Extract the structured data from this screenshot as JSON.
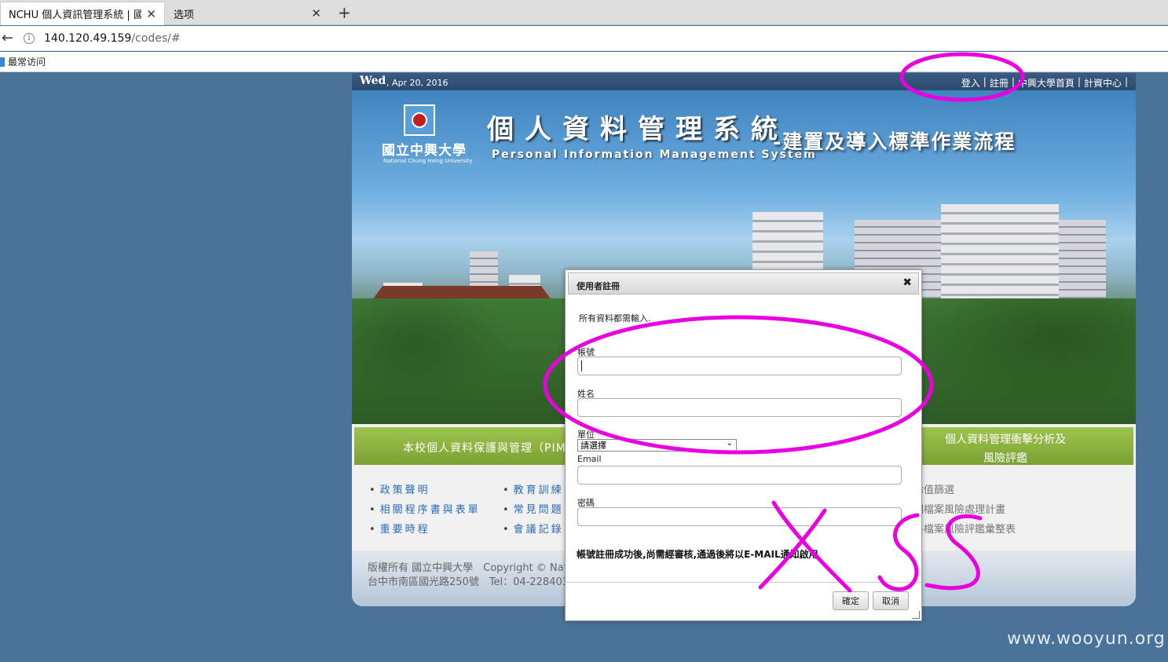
{
  "browser": {
    "tabs": [
      {
        "title": "NCHU 個人資訊管理系統 | 國...",
        "close": "✕"
      },
      {
        "title": "选项",
        "close": "✕"
      }
    ],
    "new_tab": "+",
    "url_host": "140.120.49.159",
    "url_path": "/codes/#",
    "bookmark": "最常访问"
  },
  "site": {
    "date_day": "Wed",
    "date_rest": ", Apr 20, 2016",
    "top_links": [
      "登入",
      "|",
      "註冊",
      "|",
      "中興大學首頁",
      "|",
      "計資中心",
      "|"
    ],
    "logo_zh": "國立中興大學",
    "logo_en": "National Chung Hsing University",
    "title_zh": "個人資料管理系統",
    "title_en": "Personal Information Management System",
    "title_sub": "-建置及導入標準作業流程",
    "green_left": "本校個人資料保護與管理（PIMS",
    "green_right": [
      "個人資料管理衝擊分析及",
      "風險評鑑"
    ],
    "links_col1": [
      "政策聲明",
      "相關程序書與表單",
      "重要時程"
    ],
    "links_col2": [
      "教育訓練",
      "常見問題",
      "會議記錄"
    ],
    "links_right": [
      "除值篩選",
      "個檔案風險處理計畫",
      "各檔案風險評鑑彙整表"
    ],
    "footer_line1": "版權所有 國立中興大學　Copyright © Nati",
    "footer_line2": "台中市南區國光路250號　Tel：04-228403"
  },
  "dialog": {
    "title": "使用者註冊",
    "close": "✖",
    "intro": "所有資料都需輸入.",
    "account_label": "帳號",
    "name_label": "姓名",
    "unit_label": "單位",
    "unit_selected": "請選擇",
    "email_label": "Email",
    "password_label": "密碼",
    "notice": "帳號註冊成功後,尚需經審核,通過後將以E-MAIL通知啟用",
    "ok": "確定",
    "cancel": "取消"
  },
  "annotation": {
    "handwritten": "XSS",
    "color": "#e800e0"
  },
  "watermark": "www.wooyun.org"
}
